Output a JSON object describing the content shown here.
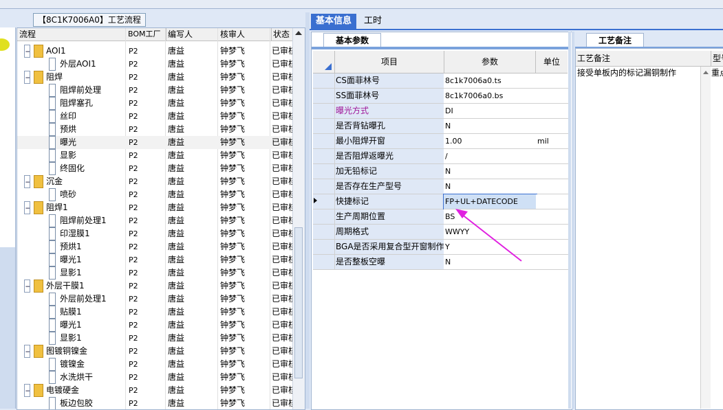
{
  "tree_panel": {
    "title": "【8C1K7006A0】工艺流程",
    "columns": [
      "流程",
      "BOM工厂",
      "编写人",
      "核审人",
      "状态"
    ],
    "rows": [
      {
        "name": "AOI1",
        "level": 1,
        "type": "folder",
        "factory": "P2",
        "writer": "唐益",
        "reviewer": "钟梦飞",
        "status": "已审核"
      },
      {
        "name": "外层AOI1",
        "level": 2,
        "type": "item",
        "factory": "P2",
        "writer": "唐益",
        "reviewer": "钟梦飞",
        "status": "已审核"
      },
      {
        "name": "阻焊",
        "level": 1,
        "type": "folder",
        "factory": "P2",
        "writer": "唐益",
        "reviewer": "钟梦飞",
        "status": "已审核"
      },
      {
        "name": "阻焊前处理",
        "level": 2,
        "type": "item",
        "factory": "P2",
        "writer": "唐益",
        "reviewer": "钟梦飞",
        "status": "已审核"
      },
      {
        "name": "阻焊塞孔",
        "level": 2,
        "type": "item",
        "factory": "P2",
        "writer": "唐益",
        "reviewer": "钟梦飞",
        "status": "已审核"
      },
      {
        "name": "丝印",
        "level": 2,
        "type": "item",
        "factory": "P2",
        "writer": "唐益",
        "reviewer": "钟梦飞",
        "status": "已审核"
      },
      {
        "name": "预烘",
        "level": 2,
        "type": "item",
        "factory": "P2",
        "writer": "唐益",
        "reviewer": "钟梦飞",
        "status": "已审核"
      },
      {
        "name": "曝光",
        "level": 2,
        "type": "item",
        "factory": "P2",
        "writer": "唐益",
        "reviewer": "钟梦飞",
        "status": "已审核",
        "selected": true
      },
      {
        "name": "显影",
        "level": 2,
        "type": "item",
        "factory": "P2",
        "writer": "唐益",
        "reviewer": "钟梦飞",
        "status": "已审核"
      },
      {
        "name": "终固化",
        "level": 2,
        "type": "item",
        "factory": "P2",
        "writer": "唐益",
        "reviewer": "钟梦飞",
        "status": "已审核"
      },
      {
        "name": "沉金",
        "level": 1,
        "type": "folder",
        "factory": "P2",
        "writer": "唐益",
        "reviewer": "钟梦飞",
        "status": "已审核"
      },
      {
        "name": "喷砂",
        "level": 2,
        "type": "item",
        "factory": "P2",
        "writer": "唐益",
        "reviewer": "钟梦飞",
        "status": "已审核"
      },
      {
        "name": "阻焊1",
        "level": 1,
        "type": "folder",
        "factory": "P2",
        "writer": "唐益",
        "reviewer": "钟梦飞",
        "status": "已审核"
      },
      {
        "name": "阻焊前处理1",
        "level": 2,
        "type": "item",
        "factory": "P2",
        "writer": "唐益",
        "reviewer": "钟梦飞",
        "status": "已审核"
      },
      {
        "name": "印湿膜1",
        "level": 2,
        "type": "item",
        "factory": "P2",
        "writer": "唐益",
        "reviewer": "钟梦飞",
        "status": "已审核"
      },
      {
        "name": "预烘1",
        "level": 2,
        "type": "item",
        "factory": "P2",
        "writer": "唐益",
        "reviewer": "钟梦飞",
        "status": "已审核"
      },
      {
        "name": "曝光1",
        "level": 2,
        "type": "item",
        "factory": "P2",
        "writer": "唐益",
        "reviewer": "钟梦飞",
        "status": "已审核"
      },
      {
        "name": "显影1",
        "level": 2,
        "type": "item",
        "factory": "P2",
        "writer": "唐益",
        "reviewer": "钟梦飞",
        "status": "已审核"
      },
      {
        "name": "外层干膜1",
        "level": 1,
        "type": "folder",
        "factory": "P2",
        "writer": "唐益",
        "reviewer": "钟梦飞",
        "status": "已审核"
      },
      {
        "name": "外层前处理1",
        "level": 2,
        "type": "item",
        "factory": "P2",
        "writer": "唐益",
        "reviewer": "钟梦飞",
        "status": "已审核"
      },
      {
        "name": "贴膜1",
        "level": 2,
        "type": "item",
        "factory": "P2",
        "writer": "唐益",
        "reviewer": "钟梦飞",
        "status": "已审核"
      },
      {
        "name": "曝光1",
        "level": 2,
        "type": "item",
        "factory": "P2",
        "writer": "唐益",
        "reviewer": "钟梦飞",
        "status": "已审核"
      },
      {
        "name": "显影1",
        "level": 2,
        "type": "item",
        "factory": "P2",
        "writer": "唐益",
        "reviewer": "钟梦飞",
        "status": "已审核"
      },
      {
        "name": "图镀铜镍金",
        "level": 1,
        "type": "folder",
        "factory": "P2",
        "writer": "唐益",
        "reviewer": "钟梦飞",
        "status": "已审核"
      },
      {
        "name": "镀镍金",
        "level": 2,
        "type": "item",
        "factory": "P2",
        "writer": "唐益",
        "reviewer": "钟梦飞",
        "status": "已审核"
      },
      {
        "name": "水洗烘干",
        "level": 2,
        "type": "item",
        "factory": "P2",
        "writer": "唐益",
        "reviewer": "钟梦飞",
        "status": "已审核"
      },
      {
        "name": "电镀硬金",
        "level": 1,
        "type": "folder",
        "factory": "P2",
        "writer": "唐益",
        "reviewer": "钟梦飞",
        "status": "已审核"
      },
      {
        "name": "板边包胶",
        "level": 2,
        "type": "item",
        "factory": "P2",
        "writer": "唐益",
        "reviewer": "钟梦飞",
        "status": "已审核"
      }
    ]
  },
  "tabs": [
    {
      "label": "基本信息",
      "active": true
    },
    {
      "label": "工时",
      "active": false
    }
  ],
  "basic_params": {
    "tab_label": "基本参数",
    "columns": [
      "项目",
      "参数",
      "单位"
    ],
    "rows": [
      {
        "name": "CS面菲林号",
        "value": "8c1k7006a0.ts",
        "unit": ""
      },
      {
        "name": "SS面菲林号",
        "value": "8c1k7006a0.bs",
        "unit": ""
      },
      {
        "name": "曝光方式",
        "value": "DI",
        "unit": "",
        "name_color": "#a0189a"
      },
      {
        "name": "是否背钻曝孔",
        "value": "N",
        "unit": ""
      },
      {
        "name": "最小阻焊开窗",
        "value": "1.00",
        "unit": "mil"
      },
      {
        "name": "是否阻焊返曝光",
        "value": "/",
        "unit": ""
      },
      {
        "name": "加无铅标记",
        "value": "N",
        "unit": ""
      },
      {
        "name": "是否存在生产型号",
        "value": "N",
        "unit": ""
      },
      {
        "name": "快捷标记",
        "value": "FP+UL+DATECODE",
        "unit": "",
        "highlighted": true
      },
      {
        "name": "生产周期位置",
        "value": "BS",
        "unit": ""
      },
      {
        "name": "周期格式",
        "value": "WWYY",
        "unit": ""
      },
      {
        "name": "BGA是否采用复合型开窗制作",
        "value": "Y",
        "unit": ""
      },
      {
        "name": "是否整板空曝",
        "value": "N",
        "unit": ""
      }
    ],
    "arrow_color": "#e020e0"
  },
  "process_notes": {
    "tab_label": "工艺备注",
    "columns": [
      "工艺备注",
      "型号"
    ],
    "rows": [
      {
        "note": "接受单板内的标记漏铜制作",
        "model": "重点"
      }
    ]
  }
}
